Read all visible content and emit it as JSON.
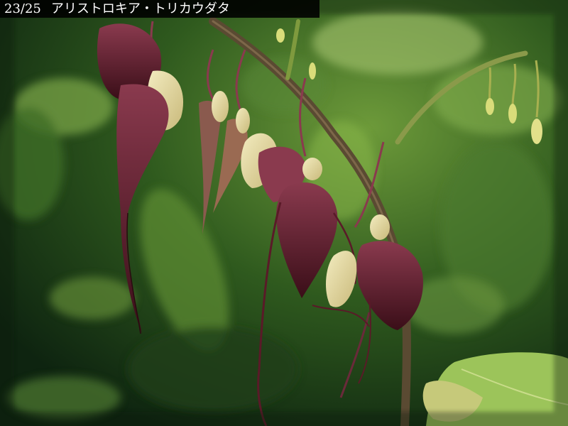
{
  "caption": {
    "counter": "23/25",
    "title": "アリストロキア・トリカウダタ"
  },
  "colors": {
    "background_foliage": "#2f5a1e",
    "leaf_light": "#8fbf4a",
    "flower_maroon": "#4a1422",
    "flower_rose": "#8a3a4e",
    "bud_cream": "#e3d9a0",
    "stem_brown": "#5a4a32"
  },
  "image": {
    "subject": "Aristolochia tricaudata flowers on a branch against green foliage"
  }
}
